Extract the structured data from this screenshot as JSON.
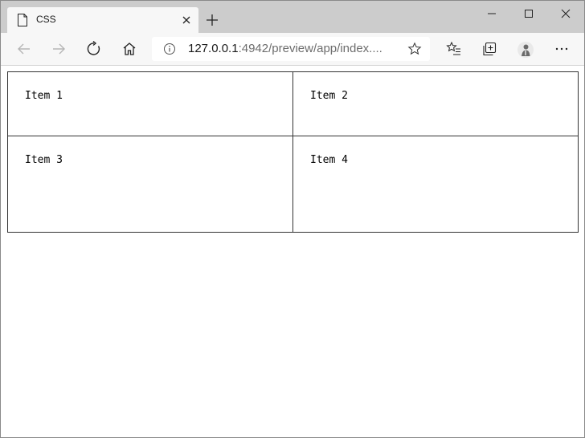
{
  "browser": {
    "tab": {
      "title": "CSS",
      "icon": "page-icon"
    },
    "address": {
      "host": "127.0.0.1",
      "rest": ":4942/preview/app/index...."
    },
    "icons": {
      "back": "back-arrow-icon",
      "forward": "forward-arrow-icon",
      "refresh": "refresh-icon",
      "home": "home-icon",
      "info": "info-icon",
      "favorite": "star-icon",
      "favorites": "favorites-icon",
      "collections": "collections-icon",
      "profile": "profile-icon",
      "more": "more-icon"
    }
  },
  "page": {
    "items": [
      "Item 1",
      "Item 2",
      "Item 3",
      "Item 4"
    ]
  }
}
